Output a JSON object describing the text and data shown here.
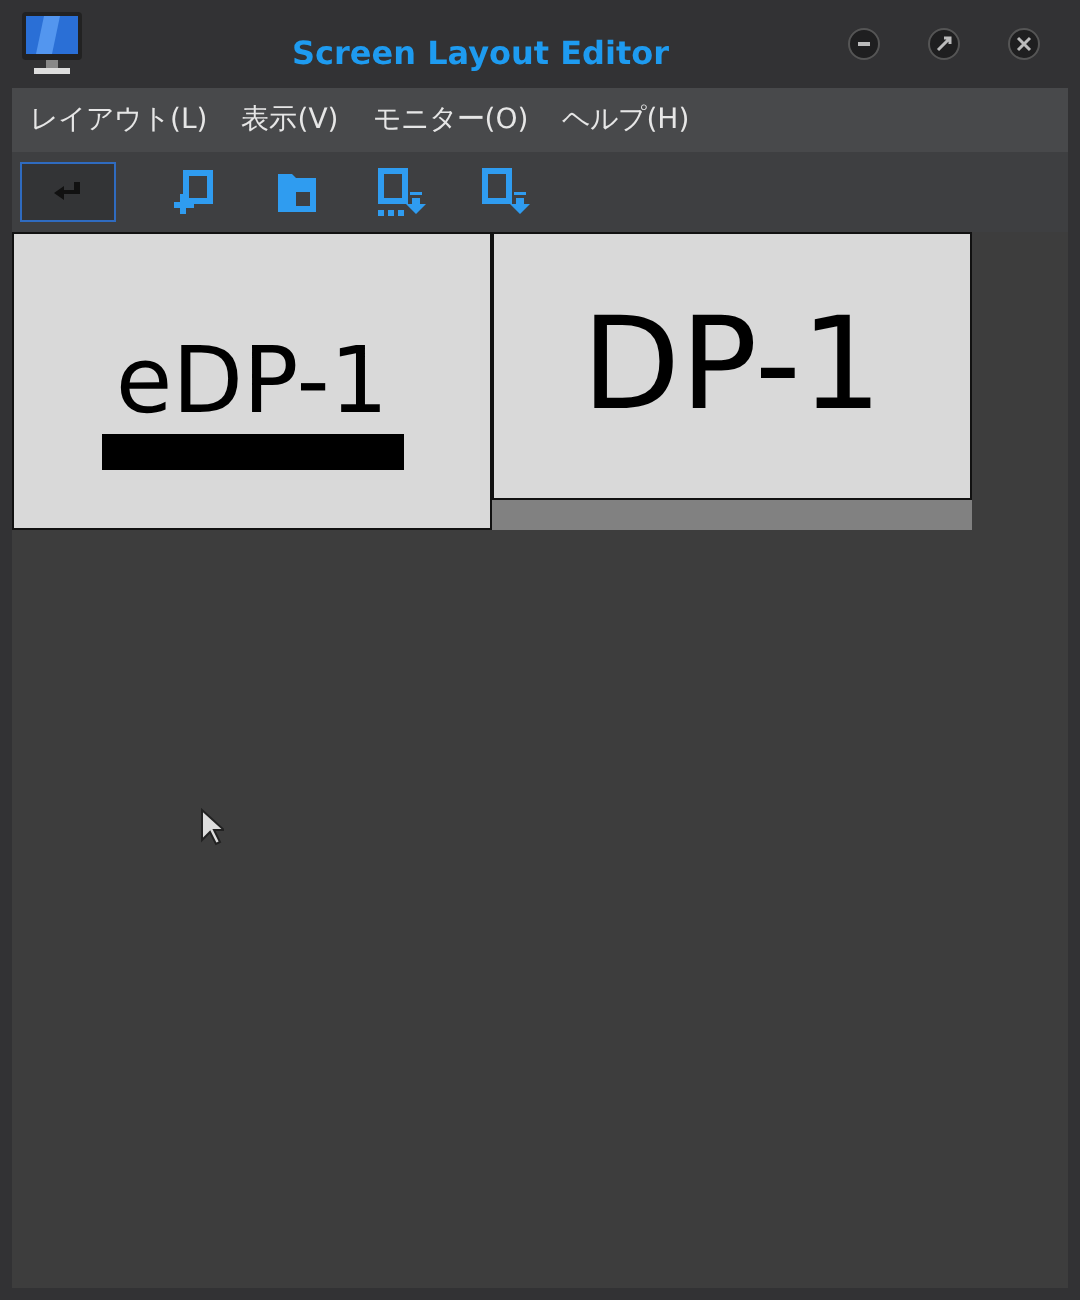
{
  "window": {
    "title": "Screen Layout Editor"
  },
  "menu": [
    "レイアウト(L)",
    "表示(V)",
    "モニター(O)",
    "ヘルプ(H)"
  ],
  "toolbar": [
    {
      "kind": "apply",
      "selected": true
    },
    {
      "kind": "new",
      "selected": false
    },
    {
      "kind": "open",
      "selected": false
    },
    {
      "kind": "save",
      "selected": false
    },
    {
      "kind": "saveas",
      "selected": false
    }
  ],
  "monitors": [
    {
      "name": "eDP-1",
      "primary": true,
      "kind": "flat"
    },
    {
      "name": "DP-1",
      "primary": false,
      "kind": "raised"
    }
  ]
}
